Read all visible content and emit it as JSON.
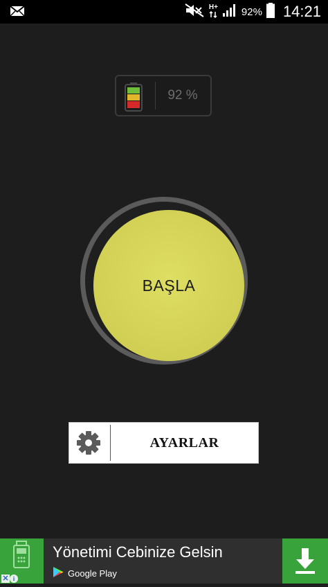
{
  "status_bar": {
    "network_type": "H+",
    "battery_percent": "92%",
    "time": "14:21"
  },
  "battery_widget": {
    "percent_text": "92 %",
    "level": 0.92
  },
  "start_button": {
    "label": "BAŞLA"
  },
  "settings_button": {
    "label": "AYARLAR"
  },
  "ad_banner": {
    "title": "Yönetimi Cebinize Gelsin",
    "store_label": "Google Play"
  },
  "colors": {
    "background": "#1d1d1d",
    "start_button": "#d6d65a",
    "ad_green": "#37a33a"
  }
}
